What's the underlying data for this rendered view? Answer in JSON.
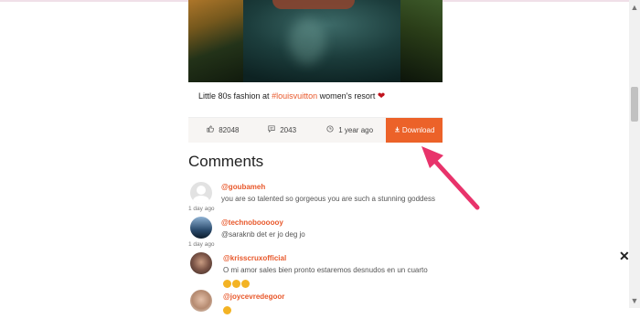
{
  "post": {
    "caption_prefix": "Little 80s fashion at ",
    "caption_tag": "#louisvuitton",
    "caption_suffix": " women's resort ",
    "caption_emoji": "❤",
    "likes": "82048",
    "comments_count": "2043",
    "time_ago": "1 year ago",
    "download_label": "Download"
  },
  "comments_section": {
    "title": "Comments",
    "items": [
      {
        "user": "@goubameh",
        "text": "you are so talented so gorgeous you are such a stunning goddess",
        "time": "1 day ago"
      },
      {
        "user": "@technoboooooy",
        "text": "@saraknb det er jo deg jo",
        "time": "1 day ago"
      },
      {
        "user": "@krisscruxofficial",
        "text": "O mi amor sales bien pronto estaremos desnudos en un cuarto",
        "time": ""
      },
      {
        "user": "@joycevredegoor",
        "text": "",
        "time": ""
      }
    ]
  },
  "icons": {
    "like": "thumbs-up-icon",
    "comment": "comment-icon",
    "time": "clock-icon",
    "download": "download-icon",
    "close": "close-icon"
  },
  "colors": {
    "accent": "#ec6229",
    "username": "#e8582b",
    "annotation_arrow": "#e8336b"
  }
}
